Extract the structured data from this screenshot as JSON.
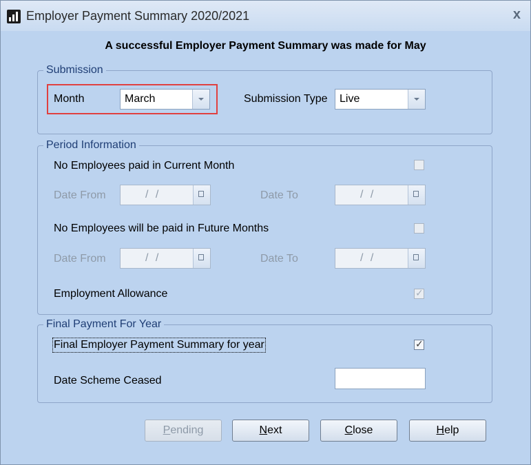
{
  "window": {
    "title": "Employer Payment Summary 2020/2021",
    "close_glyph": "x"
  },
  "headline": "A successful Employer Payment Summary was made for May",
  "submission": {
    "group_label": "Submission",
    "month_label": "Month",
    "month_value": "March",
    "type_label": "Submission Type",
    "type_value": "Live"
  },
  "period": {
    "group_label": "Period Information",
    "no_employees_current": "No Employees paid in Current Month",
    "date_from_label": "Date From",
    "date_to_label": "Date To",
    "date_placeholder": "/ /",
    "no_employees_future": "No Employees will be paid in Future Months",
    "employment_allowance": "Employment Allowance",
    "current_checked": false,
    "future_checked": false,
    "allowance_checked": true
  },
  "final_payment": {
    "group_label": "Final Payment For Year",
    "final_eps_label": "Final Employer Payment Summary for year",
    "final_eps_checked": true,
    "date_ceased_label": "Date Scheme Ceased",
    "date_ceased_value": ""
  },
  "buttons": {
    "pending": {
      "accel": "P",
      "rest": "ending"
    },
    "next": {
      "accel": "N",
      "rest": "ext"
    },
    "close": {
      "accel": "C",
      "rest": "lose"
    },
    "help": {
      "accel": "H",
      "rest": "elp"
    }
  },
  "colors": {
    "window_bg": "#bcd3ef",
    "highlight_border": "#e0403f",
    "disabled_text": "#8e9aa8"
  }
}
